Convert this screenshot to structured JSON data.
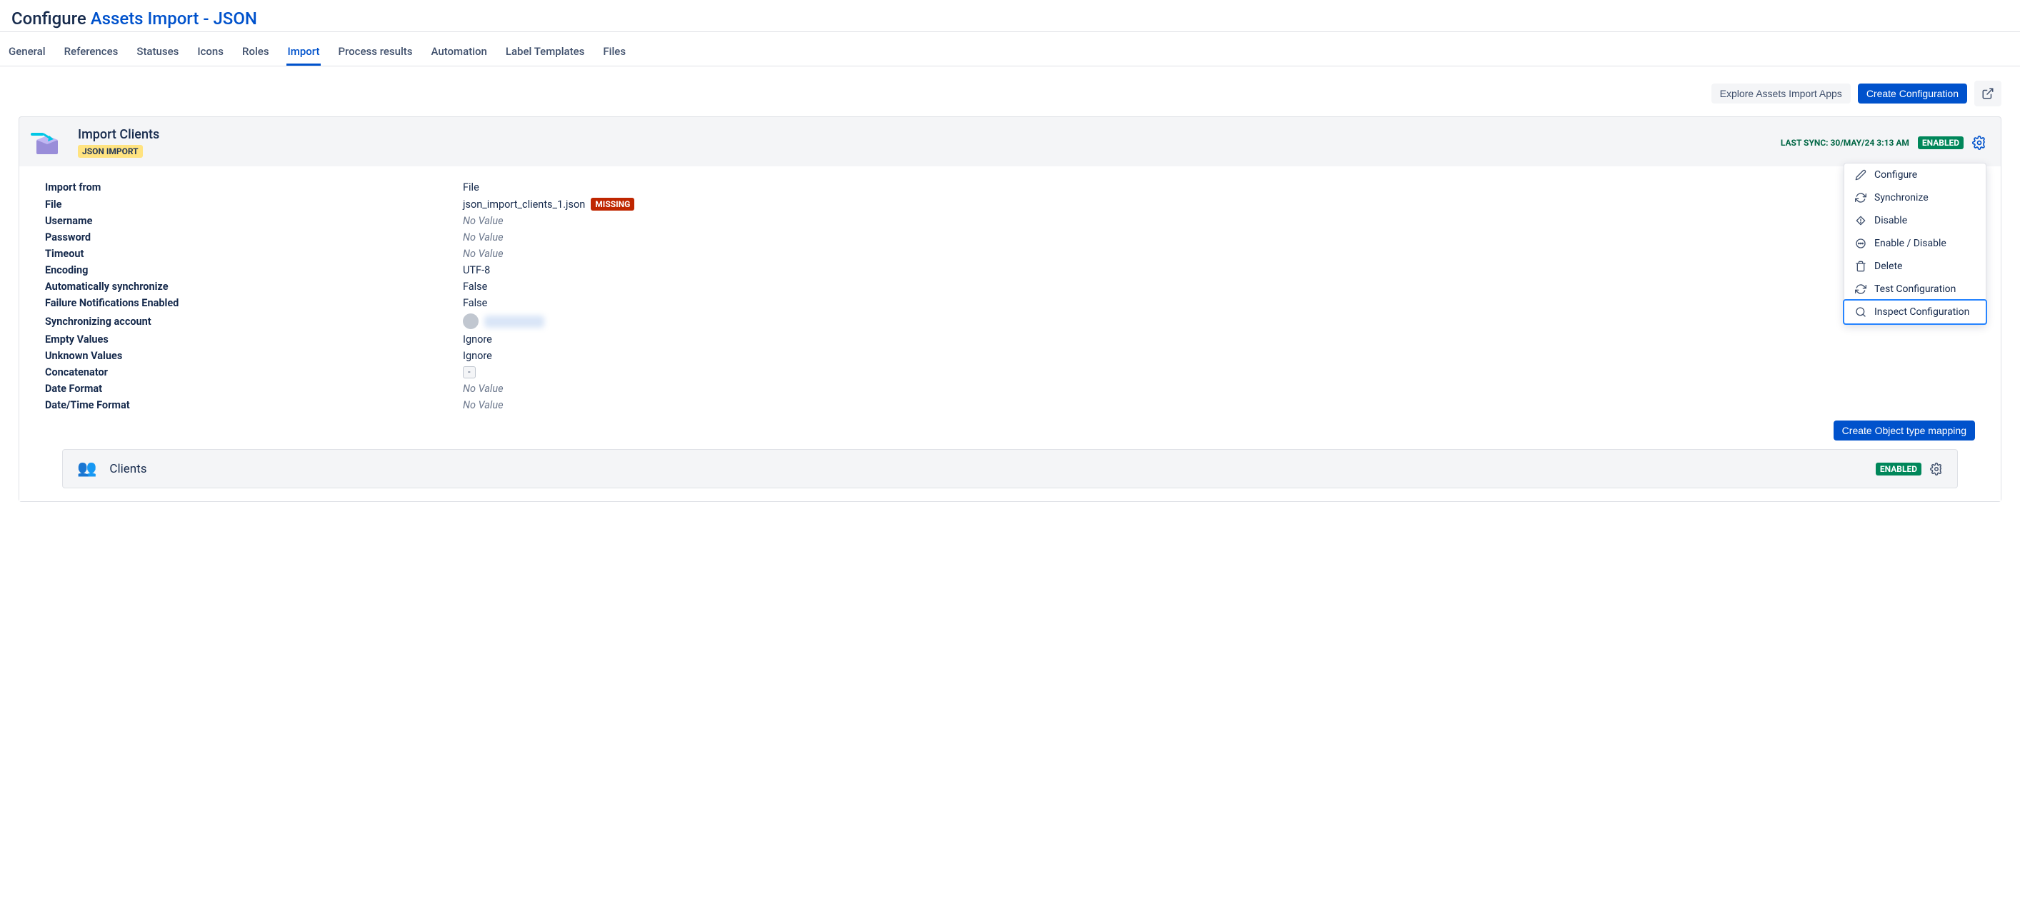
{
  "header": {
    "title_prefix": "Configure",
    "title_link": "Assets Import - JSON"
  },
  "tabs": [
    "General",
    "References",
    "Statuses",
    "Icons",
    "Roles",
    "Import",
    "Process results",
    "Automation",
    "Label Templates",
    "Files"
  ],
  "active_tab_index": 5,
  "toolbar": {
    "explore": "Explore Assets Import Apps",
    "create": "Create Configuration"
  },
  "import_panel": {
    "title": "Import Clients",
    "type_badge": "JSON IMPORT",
    "last_sync_label": "LAST SYNC: 30/MAY/24 3:13 AM",
    "status_badge": "ENABLED",
    "menu": [
      {
        "icon": "pencil",
        "label": "Configure"
      },
      {
        "icon": "sync",
        "label": "Synchronize"
      },
      {
        "icon": "diamond-exclaim",
        "label": "Disable"
      },
      {
        "icon": "dots-circle",
        "label": "Enable / Disable"
      },
      {
        "icon": "trash",
        "label": "Delete"
      },
      {
        "icon": "sync",
        "label": "Test Configuration"
      },
      {
        "icon": "search",
        "label": "Inspect Configuration",
        "highlighted": true
      }
    ],
    "fields": [
      {
        "label": "Import from",
        "value": "File"
      },
      {
        "label": "File",
        "value": "json_import_clients_1.json",
        "badge": "MISSING"
      },
      {
        "label": "Username",
        "value": "No Value",
        "novalue": true
      },
      {
        "label": "Password",
        "value": "No Value",
        "novalue": true
      },
      {
        "label": "Timeout",
        "value": "No Value",
        "novalue": true
      },
      {
        "label": "Encoding",
        "value": "UTF-8"
      },
      {
        "label": "Automatically synchronize",
        "value": "False"
      },
      {
        "label": "Failure Notifications Enabled",
        "value": "False"
      },
      {
        "label": "Synchronizing account",
        "value_blurred": true
      },
      {
        "label": "Empty Values",
        "value": "Ignore"
      },
      {
        "label": "Unknown Values",
        "value": "Ignore"
      },
      {
        "label": "Concatenator",
        "value": "-",
        "boxed": true
      },
      {
        "label": "Date Format",
        "value": "No Value",
        "novalue": true
      },
      {
        "label": "Date/Time Format",
        "value": "No Value",
        "novalue": true
      }
    ],
    "create_mapping": "Create Object type mapping"
  },
  "subpanel": {
    "title": "Clients",
    "status": "ENABLED"
  }
}
